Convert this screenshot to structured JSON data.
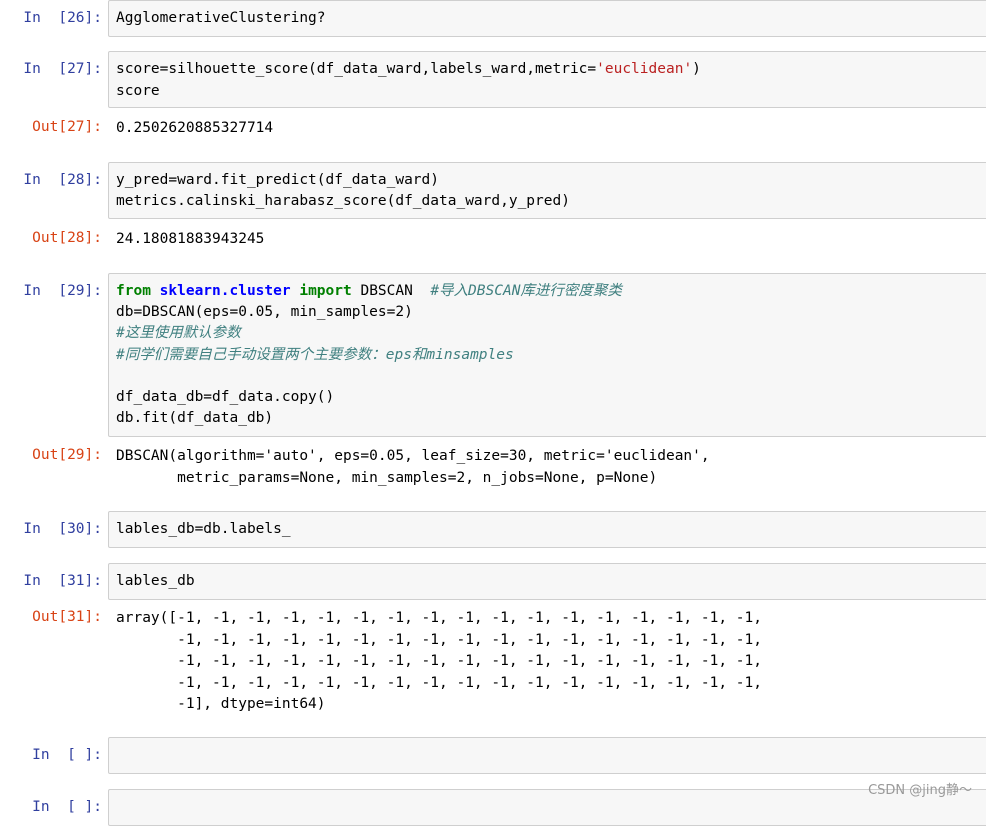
{
  "cells": [
    {
      "in_prompt": "In  [26]:",
      "lines": [
        "AgglomerativeClustering?"
      ]
    },
    {
      "in_prompt": "In  [27]:",
      "line1_pre": "score=silhouette_score(df_data_ward,labels_ward,metric=",
      "line1_str": "'euclidean'",
      "line1_post": ")",
      "line2": "score",
      "out_prompt": "Out[27]:",
      "out": "0.2502620885327714"
    },
    {
      "in_prompt": "In  [28]:",
      "line1": "y_pred=ward.fit_predict(df_data_ward)",
      "line2": "metrics.calinski_harabasz_score(df_data_ward,y_pred)",
      "out_prompt": "Out[28]:",
      "out": "24.18081883943245"
    },
    {
      "in_prompt": "In  [29]:",
      "kw_from": "from",
      "mod": "sklearn.cluster",
      "kw_import": "import",
      "name": "DBSCAN",
      "comment1": "#导入DBSCAN库进行密度聚类",
      "line2": "db=DBSCAN(eps=0.05, min_samples=2)",
      "comment2": "#这里使用默认参数",
      "comment3": "#同学们需要自己手动设置两个主要参数：eps和minsamples",
      "line5": "df_data_db=df_data.copy()",
      "line6": "db.fit(df_data_db)",
      "out_prompt": "Out[29]:",
      "out1": "DBSCAN(algorithm='auto', eps=0.05, leaf_size=30, metric='euclidean',",
      "out2": "       metric_params=None, min_samples=2, n_jobs=None, p=None)"
    },
    {
      "in_prompt": "In  [30]:",
      "line1": "lables_db=db.labels_"
    },
    {
      "in_prompt": "In  [31]:",
      "line1": "lables_db",
      "out_prompt": "Out[31]:",
      "out1": "array([-1, -1, -1, -1, -1, -1, -1, -1, -1, -1, -1, -1, -1, -1, -1, -1, -1,",
      "out2": "       -1, -1, -1, -1, -1, -1, -1, -1, -1, -1, -1, -1, -1, -1, -1, -1, -1,",
      "out3": "       -1, -1, -1, -1, -1, -1, -1, -1, -1, -1, -1, -1, -1, -1, -1, -1, -1,",
      "out4": "       -1, -1, -1, -1, -1, -1, -1, -1, -1, -1, -1, -1, -1, -1, -1, -1, -1,",
      "out5": "       -1], dtype=int64)"
    },
    {
      "in_prompt": "In  [ ]:"
    },
    {
      "in_prompt": "In  [ ]:"
    }
  ],
  "watermark": "CSDN @jing静～"
}
